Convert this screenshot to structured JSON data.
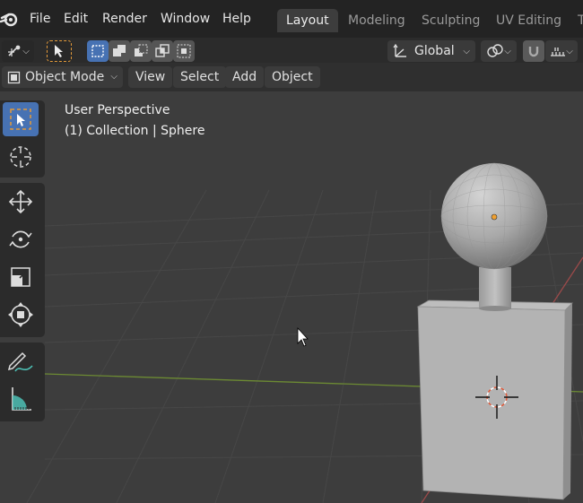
{
  "menu": {
    "items": [
      "File",
      "Edit",
      "Render",
      "Window",
      "Help"
    ]
  },
  "workspaces": {
    "tabs": [
      "Layout",
      "Modeling",
      "Sculpting",
      "UV Editing",
      "T"
    ],
    "active": "Layout"
  },
  "tool_header": {
    "orientation": "Global"
  },
  "mode_header": {
    "mode": "Object Mode",
    "menus": [
      "View",
      "Select",
      "Add",
      "Object"
    ]
  },
  "viewport": {
    "view_name": "User Perspective",
    "collection_info": "(1) Collection | Sphere"
  },
  "colors": {
    "accent": "#4772b3",
    "selection_orange": "#e39a3a",
    "x_axis": "#9c4a4a",
    "y_axis": "#6c8a33"
  },
  "icons": {
    "toolbar": [
      "select-box-icon",
      "cursor-icon",
      "move-icon",
      "rotate-icon",
      "scale-icon",
      "transform-icon",
      "annotate-icon",
      "measure-icon"
    ]
  }
}
